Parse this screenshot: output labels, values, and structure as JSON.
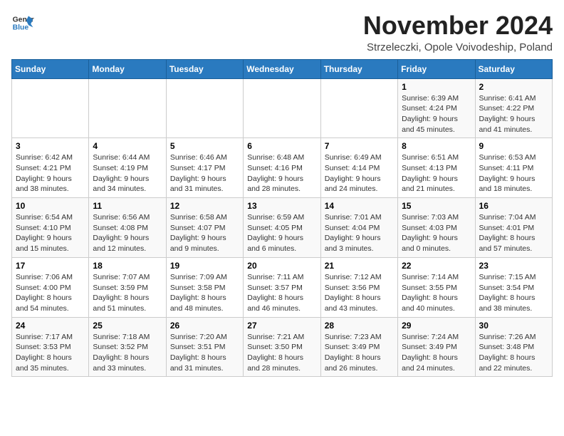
{
  "logo": {
    "line1": "General",
    "line2": "Blue"
  },
  "title": "November 2024",
  "subtitle": "Strzeleczki, Opole Voivodeship, Poland",
  "days_of_week": [
    "Sunday",
    "Monday",
    "Tuesday",
    "Wednesday",
    "Thursday",
    "Friday",
    "Saturday"
  ],
  "weeks": [
    [
      {
        "day": "",
        "info": ""
      },
      {
        "day": "",
        "info": ""
      },
      {
        "day": "",
        "info": ""
      },
      {
        "day": "",
        "info": ""
      },
      {
        "day": "",
        "info": ""
      },
      {
        "day": "1",
        "info": "Sunrise: 6:39 AM\nSunset: 4:24 PM\nDaylight: 9 hours and 45 minutes."
      },
      {
        "day": "2",
        "info": "Sunrise: 6:41 AM\nSunset: 4:22 PM\nDaylight: 9 hours and 41 minutes."
      }
    ],
    [
      {
        "day": "3",
        "info": "Sunrise: 6:42 AM\nSunset: 4:21 PM\nDaylight: 9 hours and 38 minutes."
      },
      {
        "day": "4",
        "info": "Sunrise: 6:44 AM\nSunset: 4:19 PM\nDaylight: 9 hours and 34 minutes."
      },
      {
        "day": "5",
        "info": "Sunrise: 6:46 AM\nSunset: 4:17 PM\nDaylight: 9 hours and 31 minutes."
      },
      {
        "day": "6",
        "info": "Sunrise: 6:48 AM\nSunset: 4:16 PM\nDaylight: 9 hours and 28 minutes."
      },
      {
        "day": "7",
        "info": "Sunrise: 6:49 AM\nSunset: 4:14 PM\nDaylight: 9 hours and 24 minutes."
      },
      {
        "day": "8",
        "info": "Sunrise: 6:51 AM\nSunset: 4:13 PM\nDaylight: 9 hours and 21 minutes."
      },
      {
        "day": "9",
        "info": "Sunrise: 6:53 AM\nSunset: 4:11 PM\nDaylight: 9 hours and 18 minutes."
      }
    ],
    [
      {
        "day": "10",
        "info": "Sunrise: 6:54 AM\nSunset: 4:10 PM\nDaylight: 9 hours and 15 minutes."
      },
      {
        "day": "11",
        "info": "Sunrise: 6:56 AM\nSunset: 4:08 PM\nDaylight: 9 hours and 12 minutes."
      },
      {
        "day": "12",
        "info": "Sunrise: 6:58 AM\nSunset: 4:07 PM\nDaylight: 9 hours and 9 minutes."
      },
      {
        "day": "13",
        "info": "Sunrise: 6:59 AM\nSunset: 4:05 PM\nDaylight: 9 hours and 6 minutes."
      },
      {
        "day": "14",
        "info": "Sunrise: 7:01 AM\nSunset: 4:04 PM\nDaylight: 9 hours and 3 minutes."
      },
      {
        "day": "15",
        "info": "Sunrise: 7:03 AM\nSunset: 4:03 PM\nDaylight: 9 hours and 0 minutes."
      },
      {
        "day": "16",
        "info": "Sunrise: 7:04 AM\nSunset: 4:01 PM\nDaylight: 8 hours and 57 minutes."
      }
    ],
    [
      {
        "day": "17",
        "info": "Sunrise: 7:06 AM\nSunset: 4:00 PM\nDaylight: 8 hours and 54 minutes."
      },
      {
        "day": "18",
        "info": "Sunrise: 7:07 AM\nSunset: 3:59 PM\nDaylight: 8 hours and 51 minutes."
      },
      {
        "day": "19",
        "info": "Sunrise: 7:09 AM\nSunset: 3:58 PM\nDaylight: 8 hours and 48 minutes."
      },
      {
        "day": "20",
        "info": "Sunrise: 7:11 AM\nSunset: 3:57 PM\nDaylight: 8 hours and 46 minutes."
      },
      {
        "day": "21",
        "info": "Sunrise: 7:12 AM\nSunset: 3:56 PM\nDaylight: 8 hours and 43 minutes."
      },
      {
        "day": "22",
        "info": "Sunrise: 7:14 AM\nSunset: 3:55 PM\nDaylight: 8 hours and 40 minutes."
      },
      {
        "day": "23",
        "info": "Sunrise: 7:15 AM\nSunset: 3:54 PM\nDaylight: 8 hours and 38 minutes."
      }
    ],
    [
      {
        "day": "24",
        "info": "Sunrise: 7:17 AM\nSunset: 3:53 PM\nDaylight: 8 hours and 35 minutes."
      },
      {
        "day": "25",
        "info": "Sunrise: 7:18 AM\nSunset: 3:52 PM\nDaylight: 8 hours and 33 minutes."
      },
      {
        "day": "26",
        "info": "Sunrise: 7:20 AM\nSunset: 3:51 PM\nDaylight: 8 hours and 31 minutes."
      },
      {
        "day": "27",
        "info": "Sunrise: 7:21 AM\nSunset: 3:50 PM\nDaylight: 8 hours and 28 minutes."
      },
      {
        "day": "28",
        "info": "Sunrise: 7:23 AM\nSunset: 3:49 PM\nDaylight: 8 hours and 26 minutes."
      },
      {
        "day": "29",
        "info": "Sunrise: 7:24 AM\nSunset: 3:49 PM\nDaylight: 8 hours and 24 minutes."
      },
      {
        "day": "30",
        "info": "Sunrise: 7:26 AM\nSunset: 3:48 PM\nDaylight: 8 hours and 22 minutes."
      }
    ]
  ]
}
